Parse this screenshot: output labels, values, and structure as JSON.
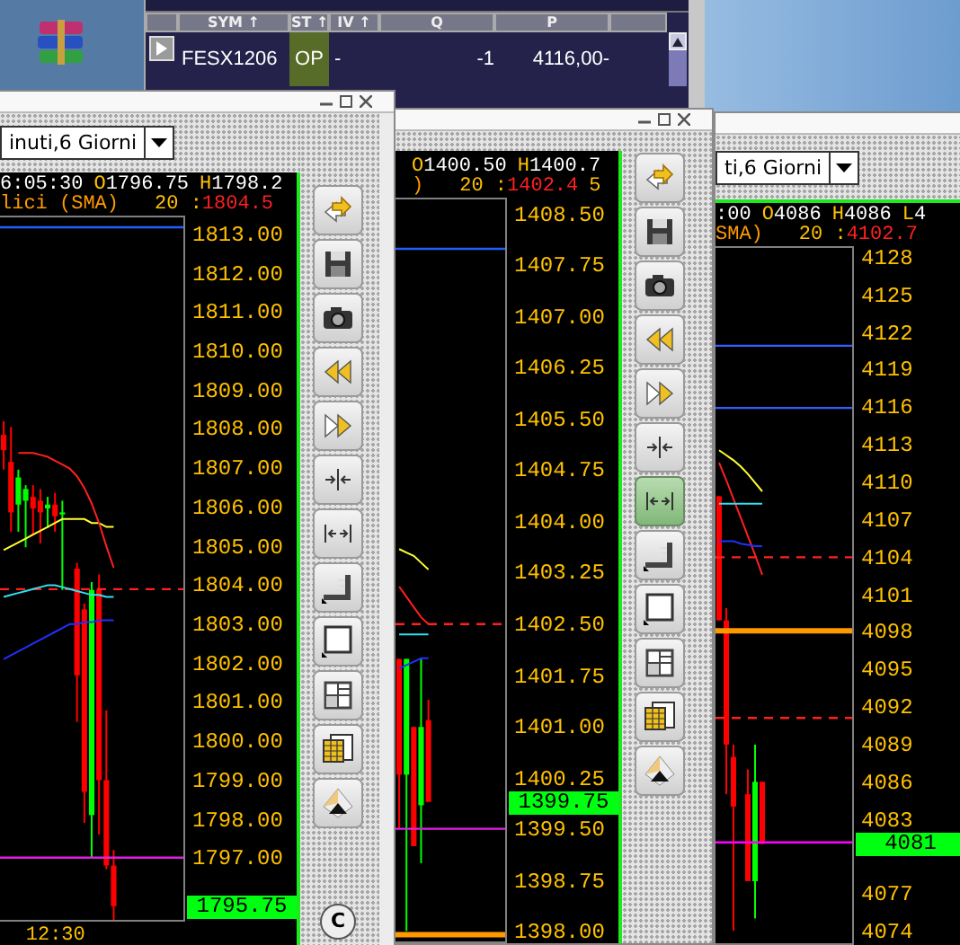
{
  "order_window": {
    "columns": [
      "SYM ↑",
      "ST ↑",
      "IV ↑",
      "Q",
      "P"
    ],
    "rows": [
      {
        "symbol": "FESX1206",
        "status": "OP",
        "color": "#566c28",
        "level_col": "-",
        "qty": "-1",
        "price": "4116,00-"
      }
    ]
  },
  "chart_windows": [
    {
      "title_buttons": [
        {
          "kind": "minimize"
        },
        {
          "kind": "maximize"
        },
        {
          "kind": "close"
        }
      ],
      "dropdown": "inuti,6 Giorni",
      "info_lines": [
        [
          {
            "kind": "time",
            "text": "6:05:30"
          },
          {
            "kind": "key",
            "text": "O"
          },
          {
            "kind": "value",
            "text": "1796.75"
          },
          {
            "kind": "key",
            "text": "H"
          },
          {
            "kind": "value",
            "text": "1798.2"
          }
        ],
        [
          {
            "kind": "indicator",
            "text": "lici (SMA)"
          },
          {
            "kind": "key",
            "text": "20 :"
          },
          {
            "kind": "alert",
            "text": "1804.5"
          }
        ]
      ],
      "chart_data": {
        "type": "candlestick",
        "ylim": [
          1795.4,
          1813.5
        ],
        "categories": [
          null,
          null,
          null,
          null,
          null,
          null,
          null,
          "12:30",
          null,
          null,
          null,
          null,
          null,
          null,
          null,
          null,
          null,
          null,
          null,
          null,
          null,
          null,
          null,
          null,
          null
        ],
        "ohlc": [
          [
            1807.9,
            1808.25,
            1807.0,
            1807.5
          ],
          [
            1807.2,
            1808.1,
            1805.4,
            1805.9
          ],
          [
            1806.1,
            1807.0,
            1805.4,
            1806.8
          ],
          [
            1806.2,
            1806.6,
            1805.0,
            1806.5
          ],
          [
            1806.3,
            1806.6,
            1805.3,
            1806.0
          ],
          [
            1806.2,
            1806.5,
            1805.1,
            1805.9
          ],
          [
            1806.0,
            1806.3,
            1805.5,
            1806.1
          ],
          [
            1806.1,
            1806.4,
            1805.4,
            1805.8
          ],
          [
            1805.9,
            1806.2,
            1803.9,
            1805.9
          ],
          null,
          [
            1804.45,
            1804.6,
            1800.5,
            1801.7
          ],
          [
            1803.4,
            1803.55,
            1797.9,
            1798.7
          ],
          [
            1798.1,
            1804.1,
            1797.0,
            1803.9
          ],
          [
            1803.9,
            1804.3,
            1797.6,
            1799.0
          ],
          [
            1799.0,
            1800.8,
            1796.7,
            1796.8
          ],
          [
            1796.8,
            1797.2,
            1795.4,
            1795.75
          ],
          null,
          null,
          null,
          null,
          null,
          null,
          null,
          null,
          null
        ],
        "yticks": [
          {
            "value": 1813,
            "label": "1813.00"
          },
          {
            "value": 1812,
            "label": "1812.00"
          },
          {
            "value": 1811,
            "label": "1811.00"
          },
          {
            "value": 1810,
            "label": "1810.00"
          },
          {
            "value": 1809,
            "label": "1809.00"
          },
          {
            "value": 1808,
            "label": "1808.00"
          },
          {
            "value": 1807,
            "label": "1807.00"
          },
          {
            "value": 1806,
            "label": "1806.00"
          },
          {
            "value": 1805,
            "label": "1805.00"
          },
          {
            "value": 1804,
            "label": "1804.00"
          },
          {
            "value": 1803,
            "label": "1803.00"
          },
          {
            "value": 1802,
            "label": "1802.00"
          },
          {
            "value": 1801,
            "label": "1801.00"
          },
          {
            "value": 1800,
            "label": "1800.00"
          },
          {
            "value": 1799,
            "label": "1799.00"
          },
          {
            "value": 1798,
            "label": "1798.00"
          },
          {
            "value": 1797,
            "label": "1797.00"
          }
        ],
        "annotations": [
          "1795.75"
        ]
      },
      "toolbar": [
        {
          "kind": "refresh",
          "selected": false
        },
        {
          "kind": "save",
          "selected": false
        },
        {
          "kind": "camera",
          "selected": false
        },
        {
          "kind": "rewind",
          "selected": false
        },
        {
          "kind": "forward",
          "selected": false
        },
        {
          "kind": "compress",
          "selected": false
        },
        {
          "kind": "expand",
          "selected": false
        },
        {
          "kind": "ruler",
          "selected": false
        },
        {
          "kind": "frame",
          "selected": false
        },
        {
          "kind": "grid",
          "selected": false
        },
        {
          "kind": "table",
          "selected": false
        },
        {
          "kind": "pyramid",
          "selected": false
        }
      ],
      "footer_button": "C"
    },
    {
      "title_buttons": [
        {
          "kind": "minimize"
        },
        {
          "kind": "maximize"
        },
        {
          "kind": "close"
        }
      ],
      "info_lines": [
        [
          {
            "kind": "key",
            "text": "O"
          },
          {
            "kind": "value",
            "text": "1400.50"
          },
          {
            "kind": "key",
            "text": "H"
          },
          {
            "kind": "value",
            "text": "1400.7"
          }
        ],
        [
          {
            "kind": "indicator",
            "text": ")"
          },
          {
            "kind": "key",
            "text": "20 :"
          },
          {
            "kind": "alert",
            "text": "1402.4"
          },
          {
            "kind": "key",
            "text": "5"
          }
        ]
      ],
      "chart_data": {
        "type": "candlestick",
        "ylim": [
          1397.85,
          1408.75
        ],
        "categories": [
          null,
          null,
          null,
          null,
          null,
          null,
          null,
          null,
          null,
          null,
          null,
          null,
          null,
          null,
          null
        ],
        "ohlc": [
          [
            1402.0,
            1402.0,
            1399.5,
            1400.3
          ],
          [
            1400.3,
            1402.0,
            1398.0,
            1402.0
          ],
          [
            1401.0,
            1401.0,
            1399.25,
            1399.25
          ],
          [
            1399.85,
            1402.0,
            1399.0,
            1401.0
          ],
          [
            1401.1,
            1401.4,
            1399.9,
            1399.9
          ],
          null,
          null,
          null,
          null,
          null,
          null,
          null,
          null,
          null,
          null
        ],
        "yticks": [
          {
            "value": 1408.5,
            "label": "1408.50"
          },
          {
            "value": 1407.75,
            "label": "1407.75"
          },
          {
            "value": 1407,
            "label": "1407.00"
          },
          {
            "value": 1406.25,
            "label": "1406.25"
          },
          {
            "value": 1405.5,
            "label": "1405.50"
          },
          {
            "value": 1404.75,
            "label": "1404.75"
          },
          {
            "value": 1404,
            "label": "1404.00"
          },
          {
            "value": 1403.25,
            "label": "1403.25"
          },
          {
            "value": 1402.5,
            "label": "1402.50"
          },
          {
            "value": 1401.75,
            "label": "1401.75"
          },
          {
            "value": 1401,
            "label": "1401.00"
          },
          {
            "value": 1400.25,
            "label": "1400.25"
          },
          {
            "value": 1399.5,
            "label": "1399.50"
          },
          {
            "value": 1398.75,
            "label": "1398.75"
          },
          {
            "value": 1398,
            "label": "1398.00"
          }
        ],
        "annotations": [
          "1399.75"
        ]
      },
      "toolbar": [
        {
          "kind": "refresh",
          "selected": false
        },
        {
          "kind": "save",
          "selected": false
        },
        {
          "kind": "camera",
          "selected": false
        },
        {
          "kind": "rewind",
          "selected": false
        },
        {
          "kind": "forward",
          "selected": false
        },
        {
          "kind": "compress",
          "selected": false
        },
        {
          "kind": "expand",
          "selected": true
        },
        {
          "kind": "ruler",
          "selected": false
        },
        {
          "kind": "frame",
          "selected": false
        },
        {
          "kind": "grid",
          "selected": false
        },
        {
          "kind": "table",
          "selected": false
        },
        {
          "kind": "pyramid",
          "selected": false
        }
      ]
    },
    {
      "dropdown": "ti,6 Giorni",
      "info_lines": [
        [
          {
            "kind": "time",
            "text": ":00"
          },
          {
            "kind": "key",
            "text": "O"
          },
          {
            "kind": "value",
            "text": "4086"
          },
          {
            "kind": "key",
            "text": "H"
          },
          {
            "kind": "value",
            "text": "4086"
          },
          {
            "kind": "key",
            "text": "L"
          },
          {
            "kind": "value",
            "text": "4"
          }
        ],
        [
          {
            "kind": "indicator",
            "text": "SMA)"
          },
          {
            "kind": "key",
            "text": "20 :"
          },
          {
            "kind": "alert",
            "text": "4102.7"
          }
        ]
      ],
      "chart_data": {
        "type": "candlestick",
        "ylim": [
          4073,
          4129
        ],
        "categories": [
          null,
          null,
          null,
          null,
          null,
          null,
          null,
          null,
          null,
          null,
          null,
          null,
          null,
          null,
          null,
          null,
          null,
          null,
          null
        ],
        "ohlc": [
          [
            4109,
            4109,
            4099,
            4099
          ],
          [
            4099,
            4100,
            4085,
            4089
          ],
          [
            4088,
            4089,
            4074,
            4084
          ],
          null,
          [
            4085,
            4087,
            4078,
            4078
          ],
          [
            4078,
            4089,
            4075,
            4086
          ],
          [
            4086,
            4086,
            4081,
            4081
          ],
          null,
          null,
          null,
          null,
          null,
          null,
          null,
          null,
          null,
          null,
          null,
          null
        ],
        "yticks": [
          {
            "value": 4128,
            "label": "4128"
          },
          {
            "value": 4125,
            "label": "4125"
          },
          {
            "value": 4122,
            "label": "4122"
          },
          {
            "value": 4119,
            "label": "4119"
          },
          {
            "value": 4116,
            "label": "4116"
          },
          {
            "value": 4113,
            "label": "4113"
          },
          {
            "value": 4110,
            "label": "4110"
          },
          {
            "value": 4107,
            "label": "4107"
          },
          {
            "value": 4104,
            "label": "4104"
          },
          {
            "value": 4101,
            "label": "4101"
          },
          {
            "value": 4098,
            "label": "4098"
          },
          {
            "value": 4095,
            "label": "4095"
          },
          {
            "value": 4092,
            "label": "4092"
          },
          {
            "value": 4089,
            "label": "4089"
          },
          {
            "value": 4086,
            "label": "4086"
          },
          {
            "value": 4083,
            "label": "4083"
          },
          {
            "value": 4077,
            "label": "4077"
          },
          {
            "value": 4074,
            "label": "4074"
          }
        ],
        "annotations": [
          "4081"
        ]
      }
    }
  ]
}
